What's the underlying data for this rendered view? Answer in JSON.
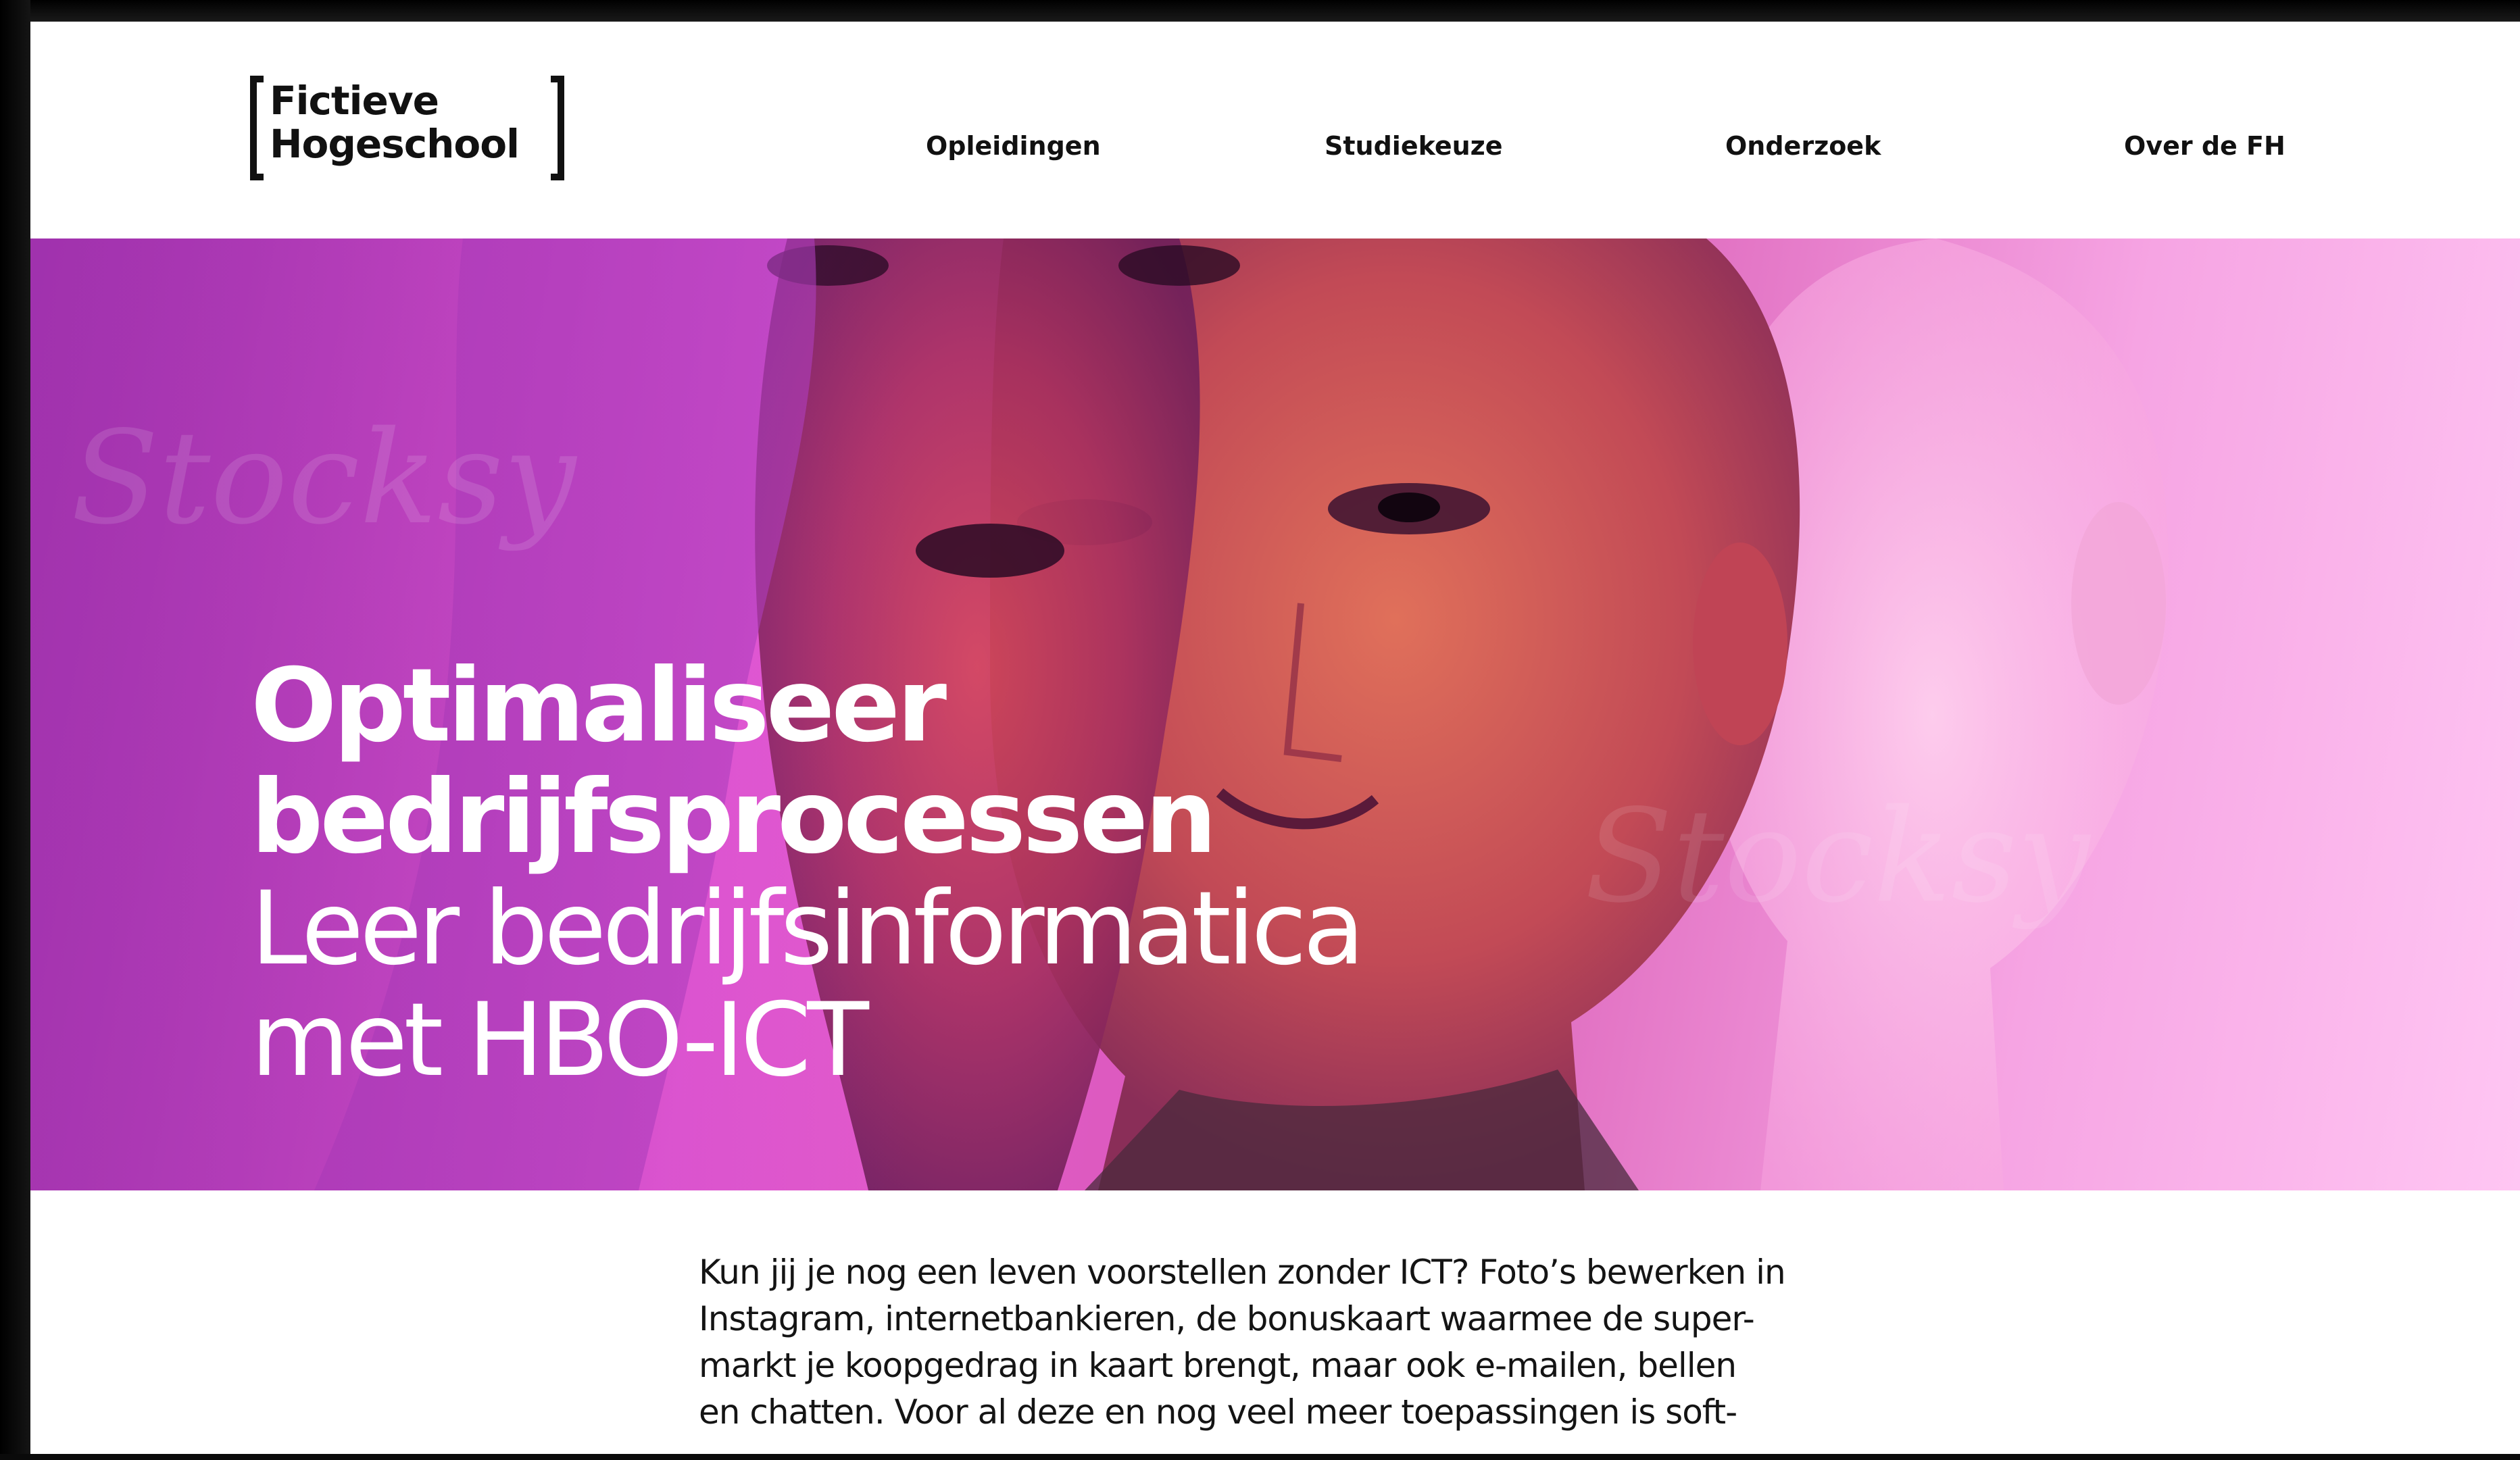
{
  "brand": {
    "logo_line_1": "Fictieve",
    "logo_line_2": "Hogeschool"
  },
  "nav": {
    "items": [
      {
        "label": "Opleidingen"
      },
      {
        "label": "Studiekeuze"
      },
      {
        "label": "Onderzoek"
      },
      {
        "label": "Over de FH"
      }
    ]
  },
  "hero": {
    "title_line_1": "Optimaliseer",
    "title_line_2": "bedrijfsprocessen",
    "subtitle_line_1": "Leer bedrijfsinformatica",
    "subtitle_line_2": "met HBO-ICT",
    "photo_watermark": "Stocksy"
  },
  "intro": {
    "lines": [
      "Kun jij je nog een leven voorstellen zonder ICT? Foto’s bewerken in",
      "Instagram, internetbankieren, de bonuskaart waarmee de super-",
      "markt je koopgedrag in kaart brengt, maar ook e-mailen, bellen",
      "en chatten. Voor al deze en nog veel meer toepassingen is soft-"
    ]
  },
  "colors": {
    "text": "#111111",
    "background": "#ffffff",
    "hero_magenta": "#e65ad6",
    "hero_violet": "#a735b3",
    "hero_pink": "#ffc6f3"
  }
}
